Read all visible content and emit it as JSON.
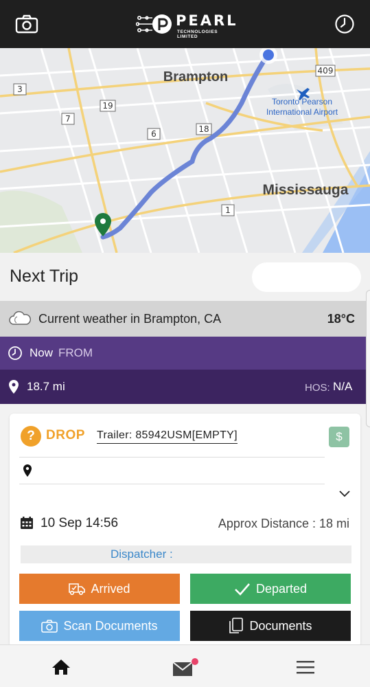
{
  "header": {
    "logo_text": "PEARL",
    "logo_subtext": "TECHNOLOGIES LIMITED",
    "left_icon": "camera-icon",
    "right_icon": "clock-icon"
  },
  "map": {
    "labels": {
      "brampton": "Brampton",
      "mississauga": "Mississauga",
      "airport_line1": "Toronto Pearson",
      "airport_line2": "International Airport"
    },
    "route_shields": [
      "3",
      "19",
      "7",
      "6",
      "18",
      "1",
      "409"
    ]
  },
  "next_trip": {
    "title": "Next Trip"
  },
  "weather": {
    "icon": "cloud-icon",
    "text": "Current weather in Brampton, CA",
    "temperature": "18°C"
  },
  "time_bar": {
    "now": "Now",
    "from": "FROM"
  },
  "distance_bar": {
    "distance": "18.7 mi",
    "hos_label": "HOS:",
    "hos_value": "N/A"
  },
  "stop_card": {
    "status_icon": "question-icon",
    "status_glyph": "?",
    "type": "DROP",
    "trailer": "Trailer: 85942USM[EMPTY]",
    "money_glyph": "$",
    "address": "",
    "datetime": "10 Sep 14:56",
    "approx_distance": "Approx Distance : 18 mi",
    "dispatcher_label": "Dispatcher :",
    "buttons": {
      "arrived": "Arrived",
      "departed": "Departed",
      "scan_documents": "Scan Documents",
      "documents": "Documents"
    }
  },
  "bottom_nav": {
    "items": [
      "home-icon",
      "mail-icon",
      "menu-icon"
    ],
    "mail_has_notification": true
  },
  "colors": {
    "header_bg": "#1f1f1f",
    "purple_light": "#563a84",
    "purple_dark": "#3c2460",
    "drop_orange": "#f0a12a",
    "arrived_orange": "#e57a2d",
    "departed_green": "#3daa62",
    "scan_blue": "#63a9e3",
    "documents_black": "#1c1c1c",
    "dispatcher_blue": "#3a87c9",
    "route_blue": "#6b84d6"
  }
}
